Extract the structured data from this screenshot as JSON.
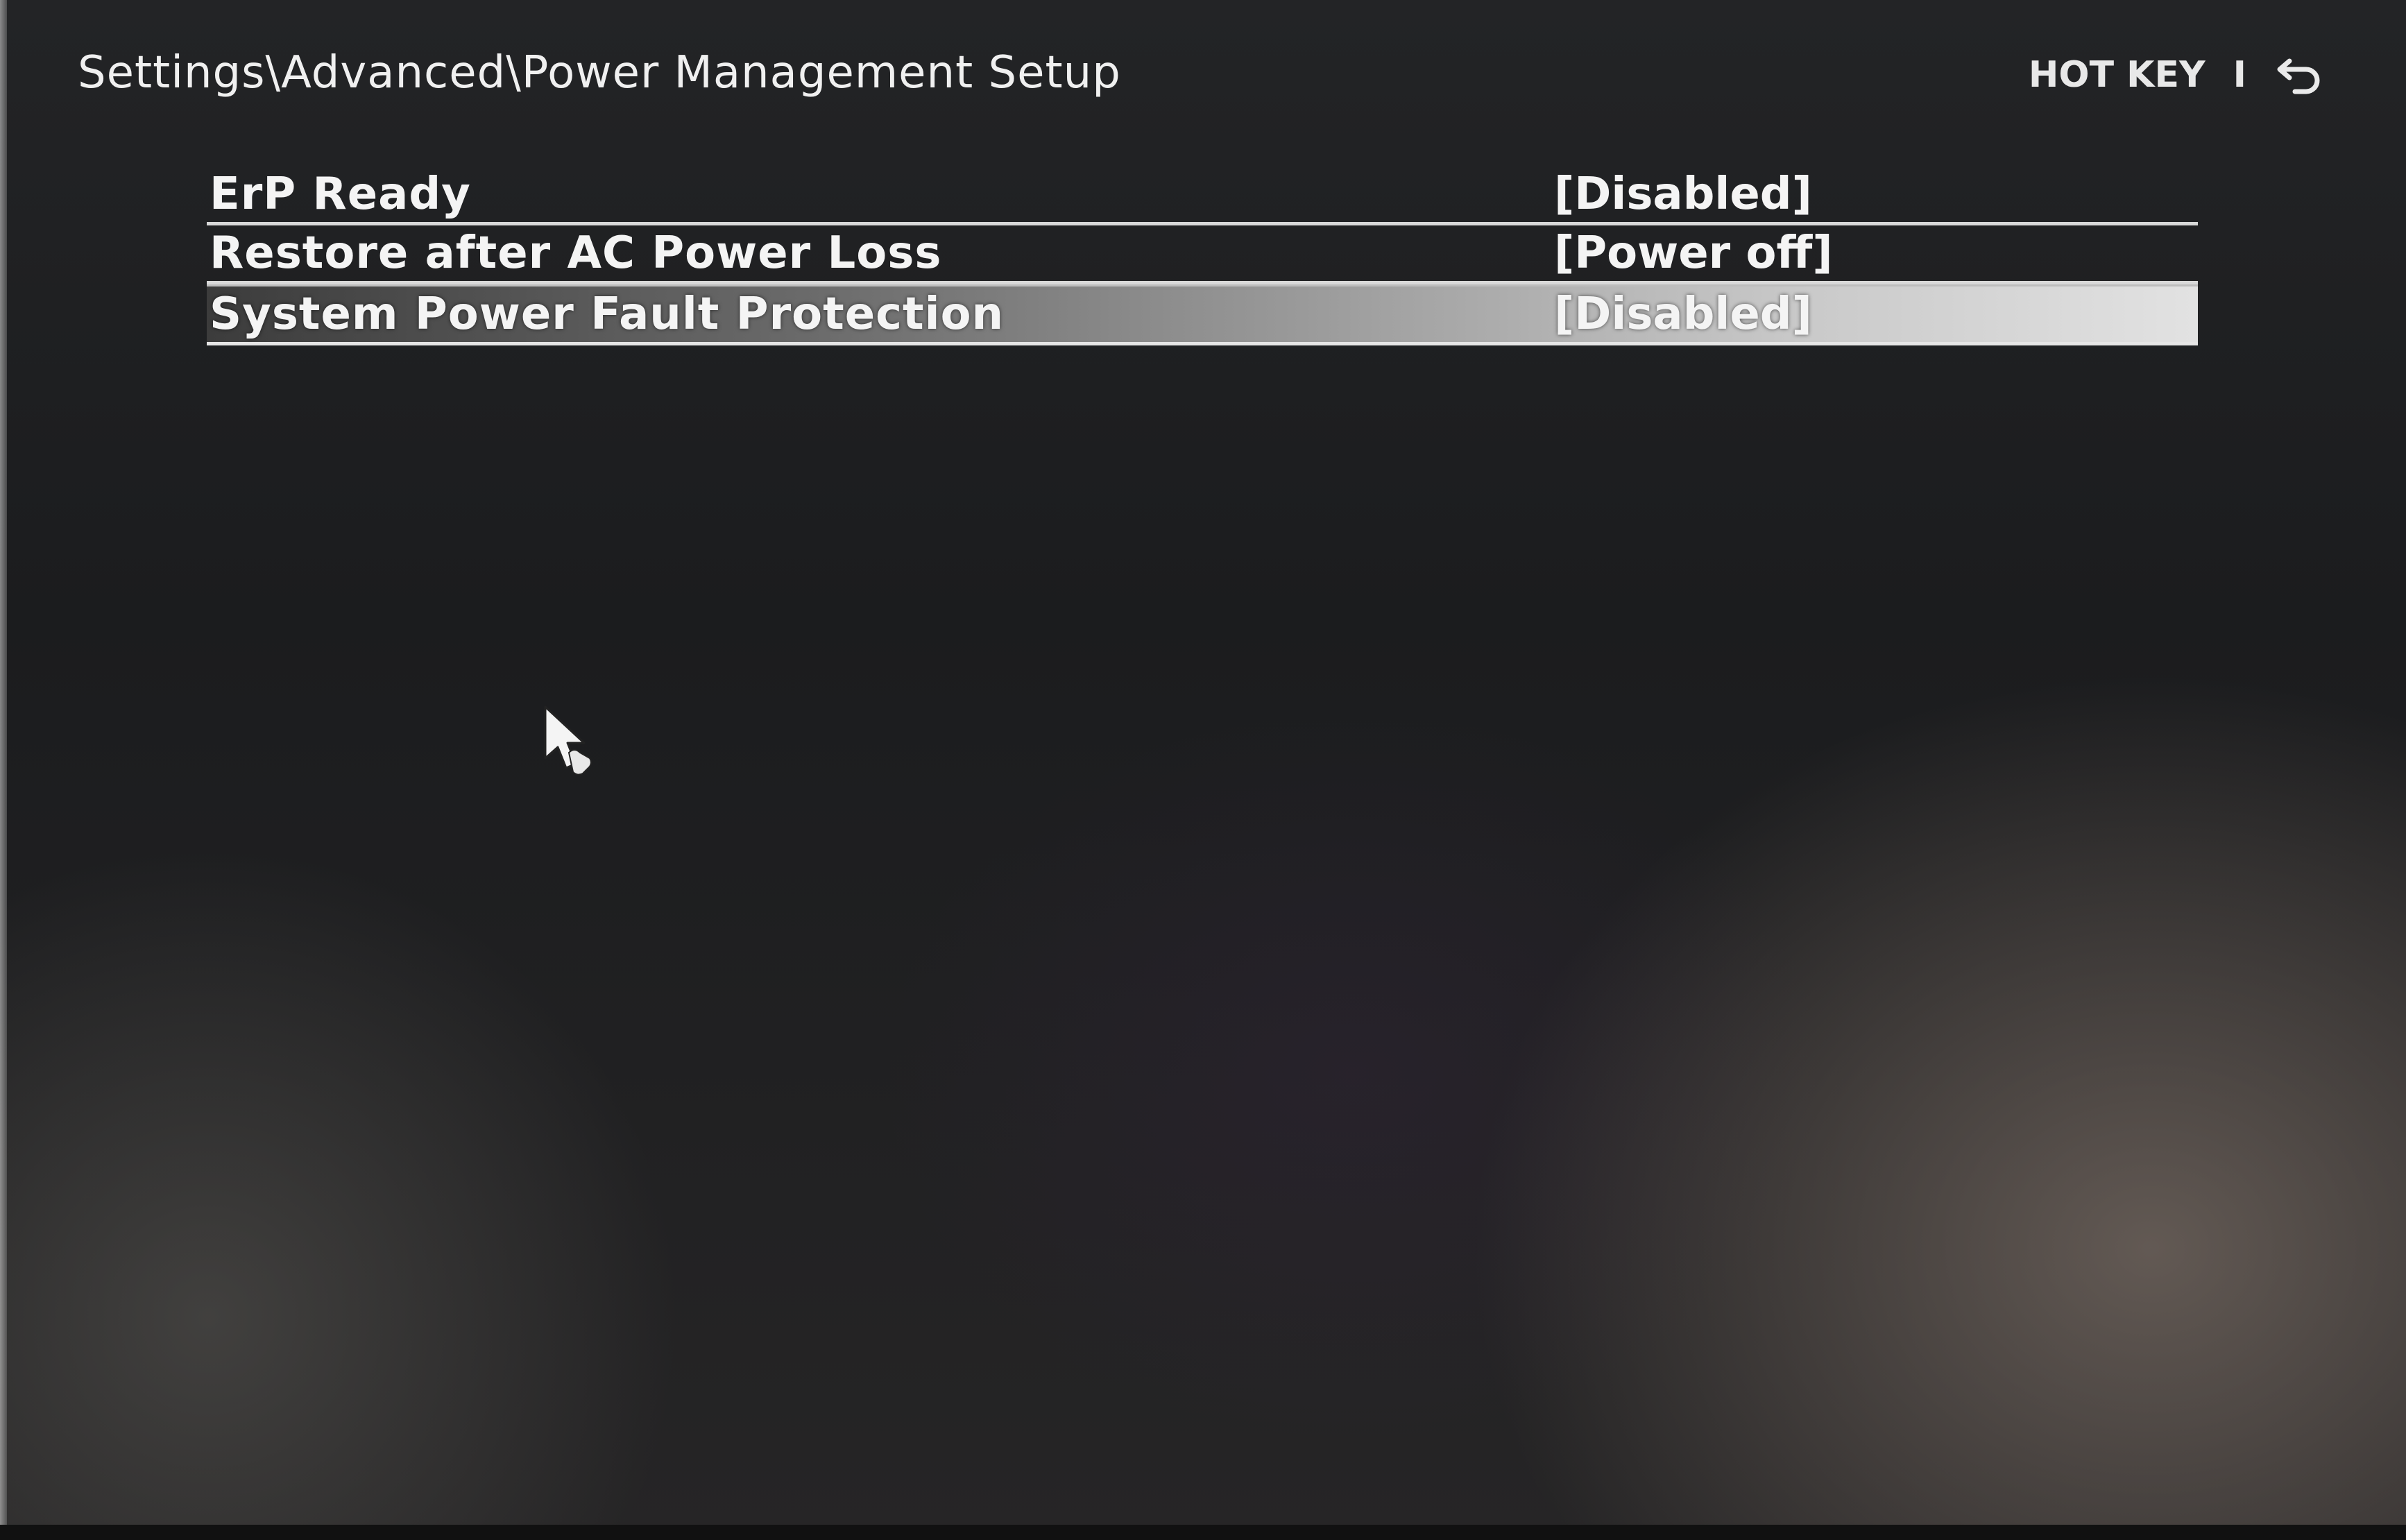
{
  "header": {
    "breadcrumb": "Settings\\Advanced\\Power Management Setup",
    "hotkey_label": "HOT KEY",
    "separator": "I",
    "back_icon": "return-arrow-icon"
  },
  "settings": [
    {
      "label": "ErP Ready",
      "value": "[Disabled]",
      "selected": false
    },
    {
      "label": "Restore after AC Power Loss",
      "value": "[Power off]",
      "selected": false
    },
    {
      "label": "System Power Fault Protection",
      "value": "[Disabled]",
      "selected": true
    }
  ],
  "pointer": {
    "icon": "mouse-pointer-icon"
  },
  "colors": {
    "background": "#1d1e20",
    "text": "#f2f2f2",
    "selection": "#c9c9c9"
  }
}
